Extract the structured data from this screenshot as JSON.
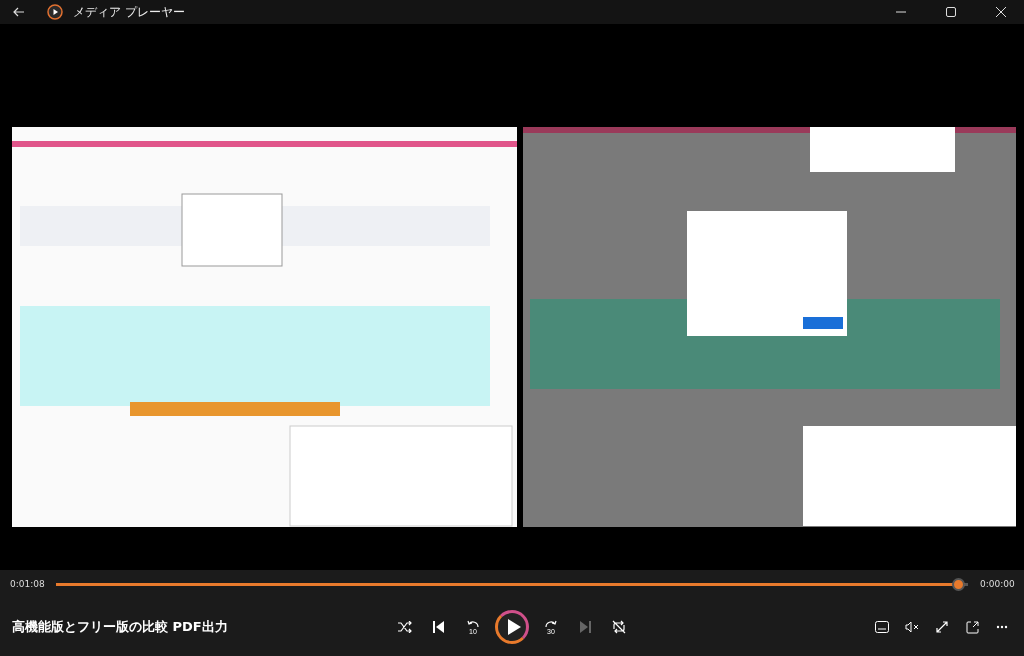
{
  "window": {
    "title": "メディア プレーヤー"
  },
  "timeline": {
    "elapsed": "0:01:08",
    "remaining": "0:00:00",
    "level": 0.997
  },
  "now_playing": {
    "title": "高機能版とフリー版の比較 PDF出力"
  },
  "controls": [
    {
      "kind": "shuffle",
      "disabled": false
    },
    {
      "kind": "previous",
      "disabled": false
    },
    {
      "kind": "back",
      "label": "10",
      "disabled": false
    },
    {
      "kind": "play",
      "disabled": false
    },
    {
      "kind": "forward",
      "label": "30",
      "disabled": false
    },
    {
      "kind": "next",
      "disabled": true
    },
    {
      "kind": "repeat",
      "disabled": false
    }
  ],
  "right_controls": [
    {
      "kind": "captions"
    },
    {
      "kind": "mute"
    },
    {
      "kind": "fullscreen"
    },
    {
      "kind": "miniplayer"
    },
    {
      "kind": "more"
    }
  ]
}
